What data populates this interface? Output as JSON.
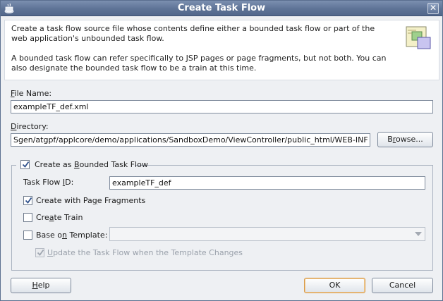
{
  "window": {
    "title": "Create Task Flow"
  },
  "header": {
    "line1": "Create a task flow source file whose contents define either a bounded task flow or part of the web application's unbounded task flow.",
    "line2": "A bounded task flow can refer specifically to JSP pages or page fragments, but not both.  You can also designate the bounded task flow to be a train at this time."
  },
  "file_name": {
    "label_prefix": "F",
    "label_rest": "ile Name:",
    "value": "exampleTF_def.xml"
  },
  "directory": {
    "label_prefix": "D",
    "label_rest": "irectory:",
    "value": "Sgen/atgpf/applcore/demo/applications/SandboxDemo/ViewController/public_html/WEB-INF",
    "browse_prefix": "B",
    "browse_u": "r",
    "browse_rest": "owse..."
  },
  "bounded": {
    "label_before": "Create as ",
    "label_u": "B",
    "label_after": "ounded Task Flow",
    "checked": true
  },
  "task_flow_id": {
    "label_before": "Task Flow ",
    "label_u": "I",
    "label_after": "D:",
    "value": "exampleTF_def"
  },
  "page_fragments": {
    "label_before": "Create with Pa",
    "label_u": "g",
    "label_after": "e Fragments",
    "checked": true
  },
  "create_train": {
    "label_before": "Cre",
    "label_u": "a",
    "label_after": "te Train",
    "checked": false
  },
  "base_template": {
    "label_before": "Base o",
    "label_u": "n",
    "label_after": " Template:",
    "checked": false,
    "selected": ""
  },
  "update_template": {
    "label_before": "",
    "label_u": "U",
    "label_after": "pdate the Task Flow when the Template Changes",
    "checked": true
  },
  "buttons": {
    "help_u": "H",
    "help_rest": "elp",
    "ok": "OK",
    "cancel": "Cancel"
  },
  "colors": {
    "titlebar": "#5e7396",
    "default_button_border": "#d89a4a"
  }
}
